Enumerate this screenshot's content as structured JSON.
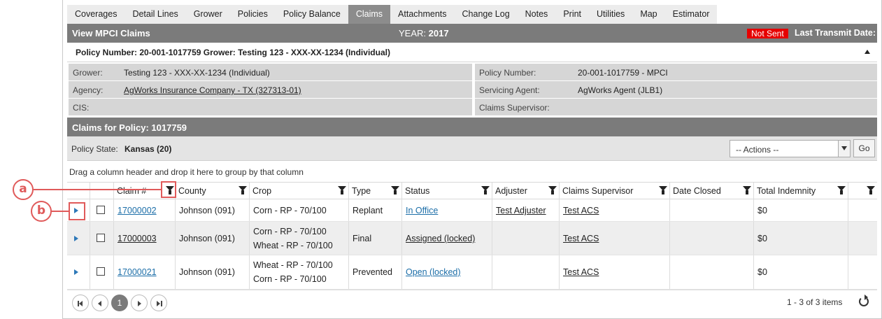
{
  "tabs": [
    "Coverages",
    "Detail Lines",
    "Grower",
    "Policies",
    "Policy Balance",
    "Claims",
    "Attachments",
    "Change Log",
    "Notes",
    "Print",
    "Utilities",
    "Map",
    "Estimator"
  ],
  "active_tab": "Claims",
  "titlebar": {
    "title": "View MPCI Claims",
    "year_label": "YEAR:",
    "year_value": "2017",
    "status_badge": "Not Sent",
    "last_transmit": "Last Transmit Date:"
  },
  "policy_header": "Policy Number: 20-001-1017759 Grower: Testing 123 - XXX-XX-1234 (Individual)",
  "info": {
    "grower_label": "Grower:",
    "grower_value": "Testing 123 - XXX-XX-1234 (Individual)",
    "policy_number_label": "Policy Number:",
    "policy_number_value": "20-001-1017759 - MPCI",
    "agency_label": "Agency:",
    "agency_value": "AgWorks Insurance Company - TX (327313-01)",
    "servicing_agent_label": "Servicing Agent:",
    "servicing_agent_value": "AgWorks Agent (JLB1)",
    "cis_label": "CIS:",
    "claims_supervisor_label": "Claims Supervisor:"
  },
  "claims_bar": "Claims for Policy: 1017759",
  "policy_state": {
    "label": "Policy State:",
    "value": "Kansas (20)",
    "actions_selected": "-- Actions --",
    "go_label": "Go"
  },
  "group_hint": "Drag a column header and drop it here to group by that column",
  "columns": [
    "Claim #",
    "County",
    "Crop",
    "Type",
    "Status",
    "Adjuster",
    "Claims Supervisor",
    "Date Closed",
    "Total Indemnity"
  ],
  "rows": [
    {
      "claim": "17000002",
      "county": "Johnson (091)",
      "crop": [
        "Corn - RP - 70/100"
      ],
      "type": "Replant",
      "status": "In Office",
      "adjuster": "Test Adjuster",
      "supervisor": "Test ACS",
      "date_closed": "",
      "indemnity": "$0"
    },
    {
      "claim": "17000003",
      "county": "Johnson (091)",
      "crop": [
        "Corn - RP - 70/100",
        "Wheat - RP - 70/100"
      ],
      "type": "Final",
      "status": "Assigned (locked)",
      "adjuster": "",
      "supervisor": "Test ACS",
      "date_closed": "",
      "indemnity": "$0"
    },
    {
      "claim": "17000021",
      "county": "Johnson (091)",
      "crop": [
        "Wheat - RP - 70/100",
        "Corn - RP - 70/100"
      ],
      "type": "Prevented",
      "status": "Open (locked)",
      "adjuster": "",
      "supervisor": "Test ACS",
      "date_closed": "",
      "indemnity": "$0"
    }
  ],
  "pager": {
    "current_page": "1",
    "count_text": "1 - 3 of 3 items"
  },
  "callouts": {
    "a": "a",
    "b": "b"
  },
  "colors": {
    "accent_bar": "#7b7b7b",
    "not_sent": "#e60000",
    "link": "#1c6ea8",
    "callout": "#e05a5a"
  }
}
